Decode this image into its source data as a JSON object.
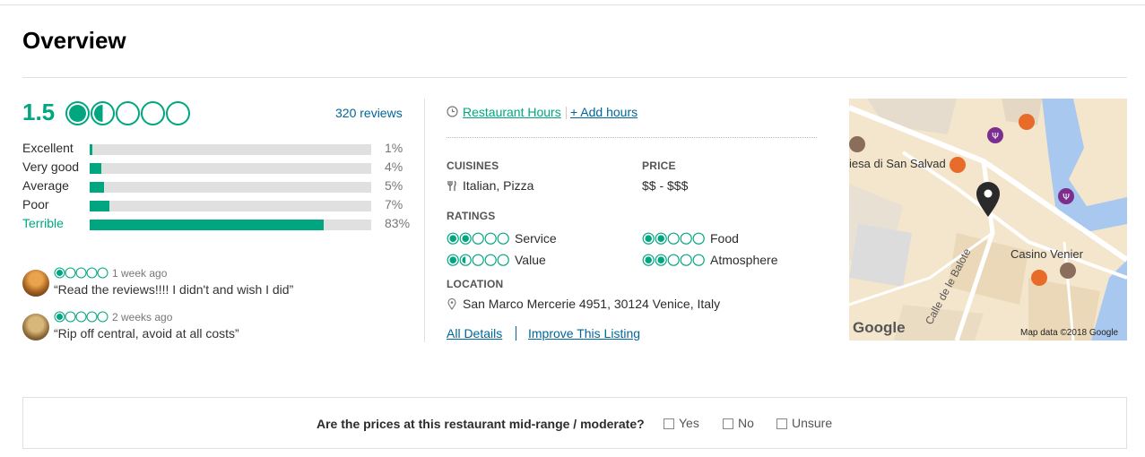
{
  "title": "Overview",
  "rating": {
    "score": "1.5",
    "bubbles": 1.5,
    "reviews_link": "320 reviews"
  },
  "histogram": [
    {
      "label": "Excellent",
      "pct": "1%",
      "value": 1,
      "active": false
    },
    {
      "label": "Very good",
      "pct": "4%",
      "value": 4,
      "active": false
    },
    {
      "label": "Average",
      "pct": "5%",
      "value": 5,
      "active": false
    },
    {
      "label": "Poor",
      "pct": "7%",
      "value": 7,
      "active": false
    },
    {
      "label": "Terrible",
      "pct": "83%",
      "value": 83,
      "active": true
    }
  ],
  "recent_reviews": [
    {
      "bubbles": 1,
      "date": "1 week ago",
      "quote": "“Read the reviews!!!! I didn't and wish I did”"
    },
    {
      "bubbles": 1,
      "date": "2 weeks ago",
      "quote": "“Rip off central, avoid at all costs”"
    }
  ],
  "hours": {
    "link": "Restaurant Hours",
    "add": "+ Add hours"
  },
  "details": {
    "cuisines_label": "CUISINES",
    "cuisines": "Italian, Pizza",
    "price_label": "PRICE",
    "price": "$$ - $$$",
    "ratings_label": "RATINGS",
    "ratings": [
      {
        "label": "Service",
        "bubbles": 2
      },
      {
        "label": "Food",
        "bubbles": 2
      },
      {
        "label": "Value",
        "bubbles": 1.5
      },
      {
        "label": "Atmosphere",
        "bubbles": 2
      }
    ],
    "location_label": "LOCATION",
    "location": "San Marco Mercerie 4951, 30124 Venice, Italy",
    "all_details": "All Details",
    "improve": "Improve This Listing"
  },
  "map": {
    "label_church": "iesa di San Salvad",
    "label_casino": "Casino Venier",
    "label_street": "Calle de le Balote",
    "logo": "Google",
    "credit": "Map data ©2018 Google"
  },
  "price_question": {
    "text": "Are the prices at this restaurant mid-range / moderate?",
    "options": [
      "Yes",
      "No",
      "Unsure"
    ]
  },
  "colors": {
    "accent": "#00a680",
    "link": "#006699",
    "bar_bg": "#e0e0e0"
  }
}
